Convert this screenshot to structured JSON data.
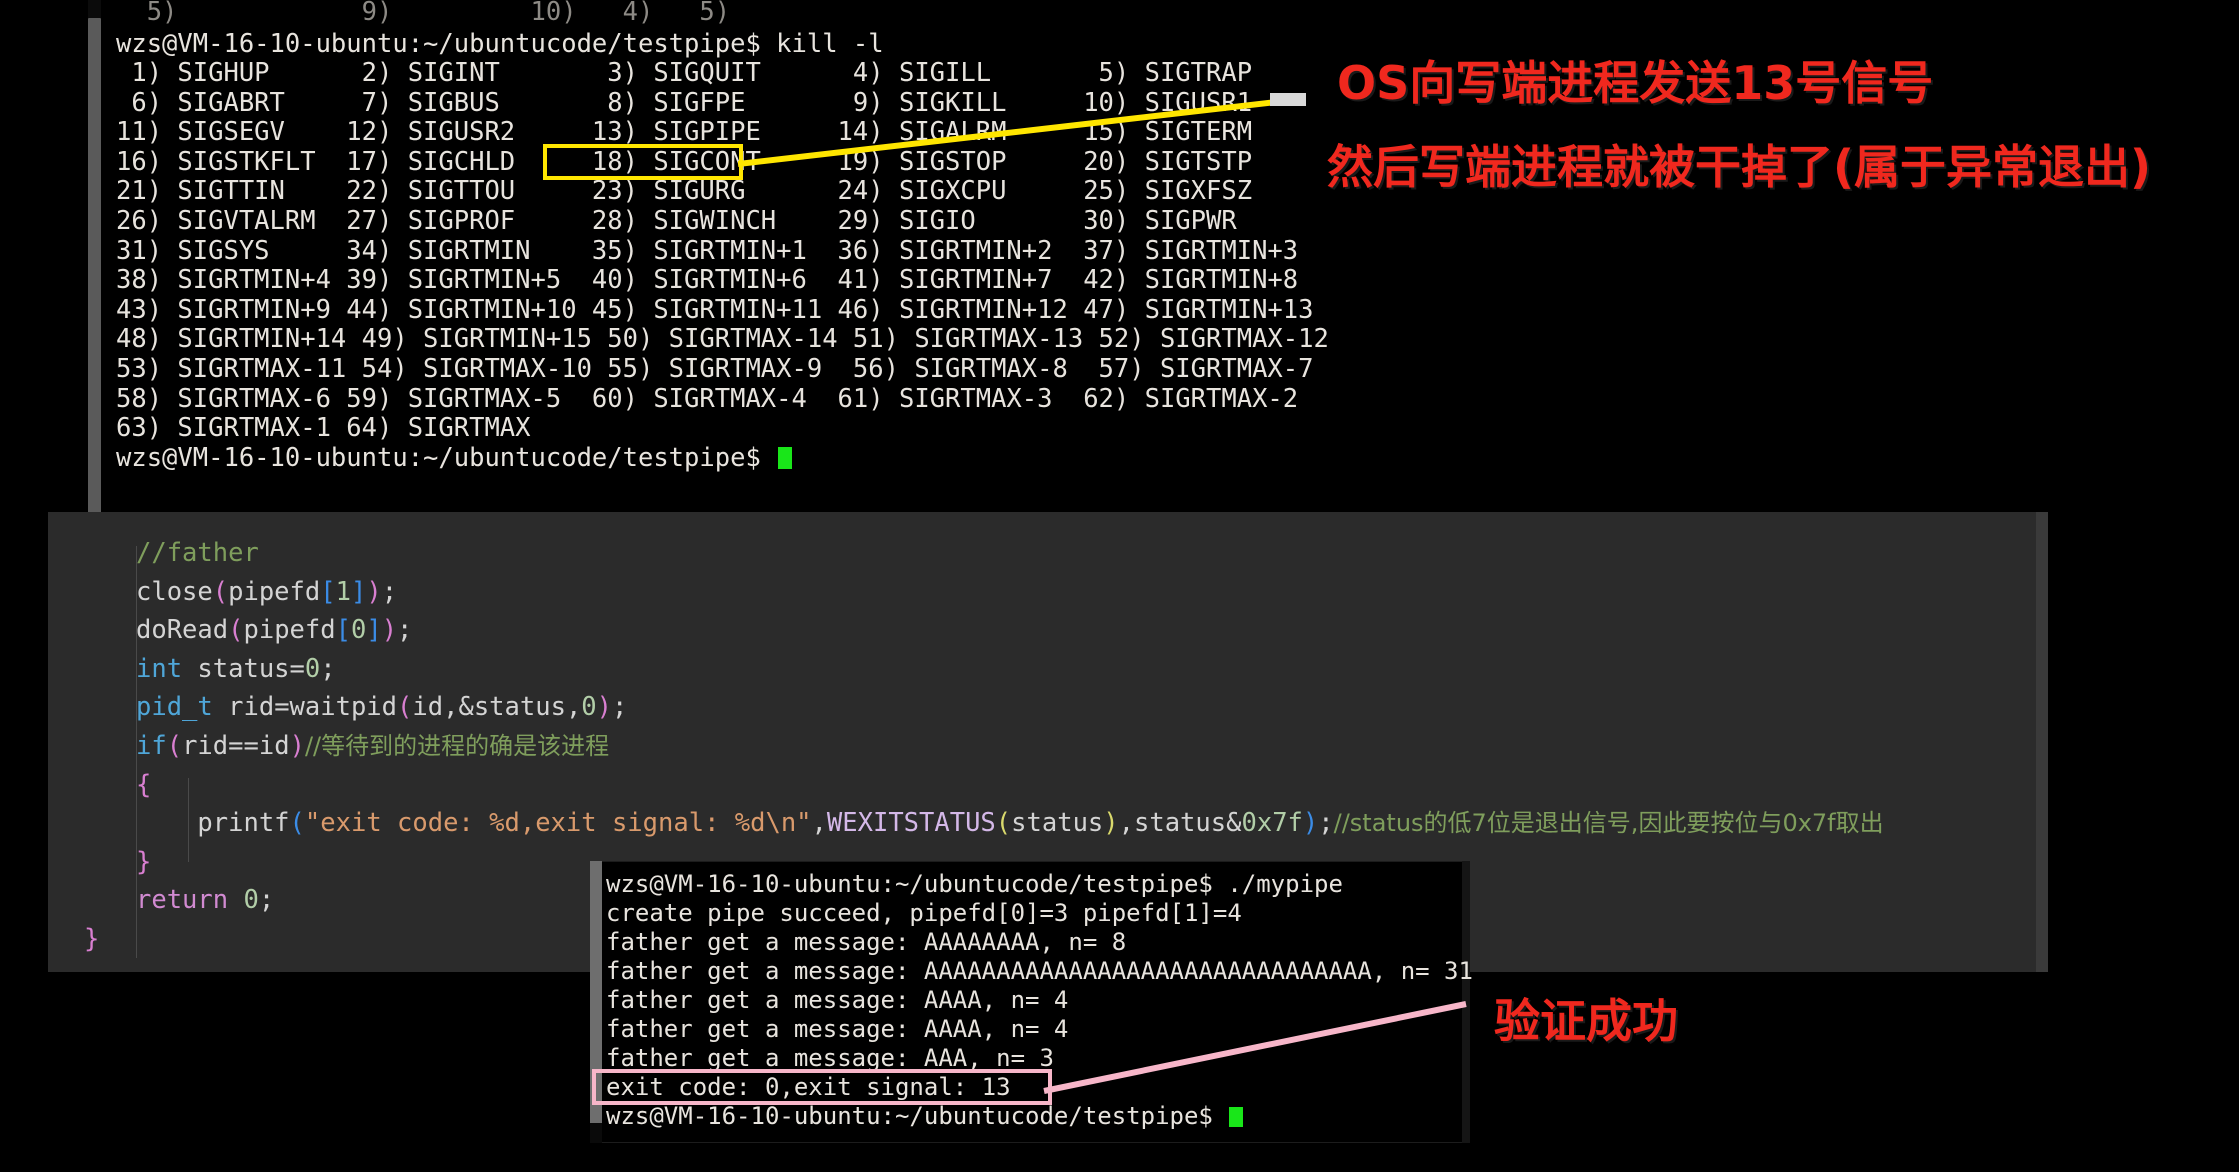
{
  "top_terminal": {
    "name": "kill-signal-list-terminal",
    "partial_top_line": "  5)            9)         10)   4)   5)",
    "prompt_line": "wzs@VM-16-10-ubuntu:~/ubuntucode/testpipe$ kill -l",
    "signal_rows": [
      [
        " 1) SIGHUP",
        " 2) SIGINT",
        " 3) SIGQUIT",
        " 4) SIGILL",
        " 5) SIGTRAP"
      ],
      [
        " 6) SIGABRT",
        " 7) SIGBUS",
        " 8) SIGFPE",
        " 9) SIGKILL",
        "10) SIGUSR1"
      ],
      [
        "11) SIGSEGV",
        "12) SIGUSR2",
        "13) SIGPIPE",
        "14) SIGALRM",
        "15) SIGTERM"
      ],
      [
        "16) SIGSTKFLT",
        "17) SIGCHLD",
        "18) SIGCONT",
        "19) SIGSTOP",
        "20) SIGTSTP"
      ],
      [
        "21) SIGTTIN",
        "22) SIGTTOU",
        "23) SIGURG",
        "24) SIGXCPU",
        "25) SIGXFSZ"
      ],
      [
        "26) SIGVTALRM",
        "27) SIGPROF",
        "28) SIGWINCH",
        "29) SIGIO",
        "30) SIGPWR"
      ],
      [
        "31) SIGSYS",
        "34) SIGRTMIN",
        "35) SIGRTMIN+1",
        "36) SIGRTMIN+2",
        "37) SIGRTMIN+3"
      ],
      [
        "38) SIGRTMIN+4",
        "39) SIGRTMIN+5",
        "40) SIGRTMIN+6",
        "41) SIGRTMIN+7",
        "42) SIGRTMIN+8"
      ],
      [
        "43) SIGRTMIN+9",
        "44) SIGRTMIN+10",
        "45) SIGRTMIN+11",
        "46) SIGRTMIN+12",
        "47) SIGRTMIN+13"
      ],
      [
        "48) SIGRTMIN+14",
        "49) SIGRTMIN+15",
        "50) SIGRTMAX-14",
        "51) SIGRTMAX-13",
        "52) SIGRTMAX-12"
      ],
      [
        "53) SIGRTMAX-11",
        "54) SIGRTMAX-10",
        "55) SIGRTMAX-9",
        "56) SIGRTMAX-8",
        "57) SIGRTMAX-7"
      ],
      [
        "58) SIGRTMAX-6",
        "59) SIGRTMAX-5",
        "60) SIGRTMAX-4",
        "61) SIGRTMAX-3",
        "62) SIGRTMAX-2"
      ],
      [
        "63) SIGRTMAX-1",
        "64) SIGRTMAX",
        "",
        "",
        ""
      ]
    ],
    "signal_text_block": " 1) SIGHUP\t  2) SIGINT\t  3) SIGQUIT\t  4) SIGILL\t  5) SIGTRAP\n 6) SIGABRT\t  7) SIGBUS\t  8) SIGFPE\t  9) SIGKILL\t 10) SIGUSR1\n11) SIGSEGV\t 12) SIGUSR2\t 13) SIGPIPE\t 14) SIGALRM\t 15) SIGTERM\n16) SIGSTKFLT\t 17) SIGCHLD\t 18) SIGCONT\t 19) SIGSTOP\t 20) SIGTSTP\n21) SIGTTIN\t 22) SIGTTOU\t 23) SIGURG\t 24) SIGXCPU\t 25) SIGXFSZ\n26) SIGVTALRM\t 27) SIGPROF\t 28) SIGWINCH\t 29) SIGIO\t 30) SIGPWR\n31) SIGSYS\t 34) SIGRTMIN\t 35) SIGRTMIN+1\t 36) SIGRTMIN+2\t 37) SIGRTMIN+3\n38) SIGRTMIN+4\t 39) SIGRTMIN+5\t 40) SIGRTMIN+6\t 41) SIGRTMIN+7\t 42) SIGRTMIN+8\n43) SIGRTMIN+9\t 44) SIGRTMIN+10 45) SIGRTMIN+11 46) SIGRTMIN+12 47) SIGRTMIN+13\n48) SIGRTMIN+14 49) SIGRTMIN+15 50) SIGRTMAX-14 51) SIGRTMAX-13 52) SIGRTMAX-12\n53) SIGRTMAX-11 54) SIGRTMAX-10 55) SIGRTMAX-9\t 56) SIGRTMAX-8\t 57) SIGRTMAX-7\n58) SIGRTMAX-6\t 59) SIGRTMAX-5\t 60) SIGRTMAX-4\t 61) SIGRTMAX-3\t 62) SIGRTMAX-2\n63) SIGRTMAX-1\t 64) SIGRTMAX",
    "final_prompt": "wzs@VM-16-10-ubuntu:~/ubuntucode/testpipe$",
    "highlighted_signal": "13) SIGPIPE"
  },
  "annotations": {
    "top_red_line1": "OS向写端进程发送13号信号",
    "top_red_line2": "然后写端进程就被干掉了(属于异常退出)",
    "bottom_red": "验证成功",
    "highlight_yellow_color": "#ffe600",
    "highlight_pink_color": "#f7b6c9",
    "red_color": "#f0281e"
  },
  "editor": {
    "name": "code-editor-panel",
    "background": "#2b2b2b",
    "lines": [
      {
        "id": 1,
        "text": "//father"
      },
      {
        "id": 2,
        "text": "close(pipefd[1]);"
      },
      {
        "id": 3,
        "text": "doRead(pipefd[0]);"
      },
      {
        "id": 4,
        "text": "int status=0;"
      },
      {
        "id": 5,
        "text": "pid_t rid=waitpid(id,&status,0);"
      },
      {
        "id": 6,
        "text": "if(rid==id)//等待到的进程的确是该进程"
      },
      {
        "id": 7,
        "text": "{"
      },
      {
        "id": 8,
        "text": "    printf(\"exit code: %d,exit signal: %d\\n\",WEXITSTATUS(status),status&0x7f);//status的低7位是退出信号,因此要按位与0x7f取出"
      },
      {
        "id": 9,
        "text": "}"
      },
      {
        "id": 10,
        "text": "return 0;"
      },
      {
        "id": 11,
        "text": "}"
      }
    ],
    "comment_line6_code": "if(rid==id)",
    "comment_line6_cn": "//等待到的进程的确是该进程",
    "printf_format": "\"exit code: %d,exit signal: %d\\n\"",
    "printf_args": "WEXITSTATUS(status),status&0x7f",
    "printf_comment_cn": "//status的低7位是退出信号,因此要按位与0x7f取出"
  },
  "bottom_terminal": {
    "name": "program-output-terminal",
    "lines": [
      "wzs@VM-16-10-ubuntu:~/ubuntucode/testpipe$ ./mypipe",
      "create pipe succeed, pipefd[0]=3 pipefd[1]=4",
      "father get a message: AAAAAAAA, n= 8",
      "father get a message: AAAAAAAAAAAAAAAAAAAAAAAAAAAAAAA, n= 31",
      "father get a message: AAAA, n= 4",
      "father get a message: AAAA, n= 4",
      "father get a message: AAA, n= 3",
      "exit code: 0,exit signal: 13"
    ],
    "highlighted_line": "exit code: 0,exit signal: 13",
    "final_prompt": "wzs@VM-16-10-ubuntu:~/ubuntucode/testpipe$",
    "command": "./mypipe"
  }
}
